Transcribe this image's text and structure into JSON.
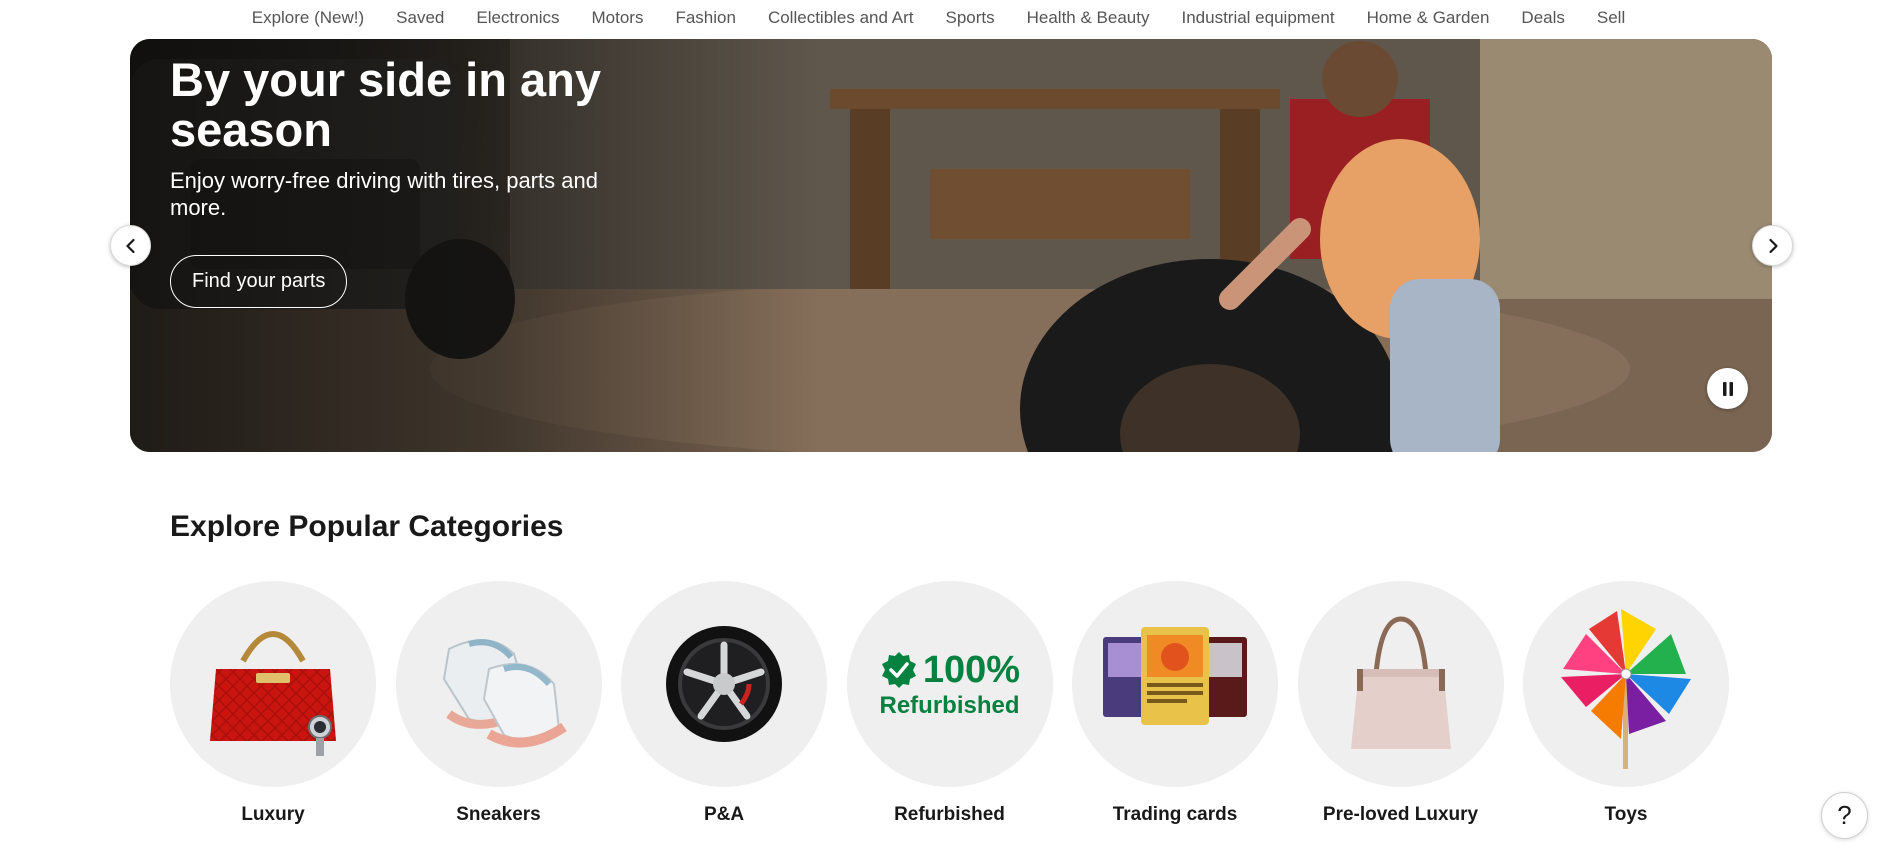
{
  "nav": {
    "items": [
      {
        "label": "Explore (New!)"
      },
      {
        "label": "Saved"
      },
      {
        "label": "Electronics"
      },
      {
        "label": "Motors"
      },
      {
        "label": "Fashion"
      },
      {
        "label": "Collectibles and Art"
      },
      {
        "label": "Sports"
      },
      {
        "label": "Health & Beauty"
      },
      {
        "label": "Industrial equipment"
      },
      {
        "label": "Home & Garden"
      },
      {
        "label": "Deals"
      },
      {
        "label": "Sell"
      }
    ]
  },
  "hero": {
    "title": "By your side in any season",
    "subtitle": "Enjoy worry-free driving with tires, parts and more.",
    "cta_label": "Find your parts",
    "prev_icon": "chevron-left-icon",
    "next_icon": "chevron-right-icon",
    "pause_icon": "pause-icon"
  },
  "categories": {
    "title": "Explore Popular Categories",
    "items": [
      {
        "label": "Luxury",
        "icon": "handbag-watch-image"
      },
      {
        "label": "Sneakers",
        "icon": "sneakers-image"
      },
      {
        "label": "P&A",
        "icon": "wheel-image"
      },
      {
        "label": "Refurbished",
        "icon": "refurbished-badge-image",
        "badge_text": "100%",
        "badge_sub": "Refurbished",
        "badge_color": "#05823f"
      },
      {
        "label": "Trading cards",
        "icon": "trading-cards-image"
      },
      {
        "label": "Pre-loved Luxury",
        "icon": "tote-bag-image"
      },
      {
        "label": "Toys",
        "icon": "pinwheel-image"
      }
    ]
  },
  "help": {
    "label": "?"
  }
}
